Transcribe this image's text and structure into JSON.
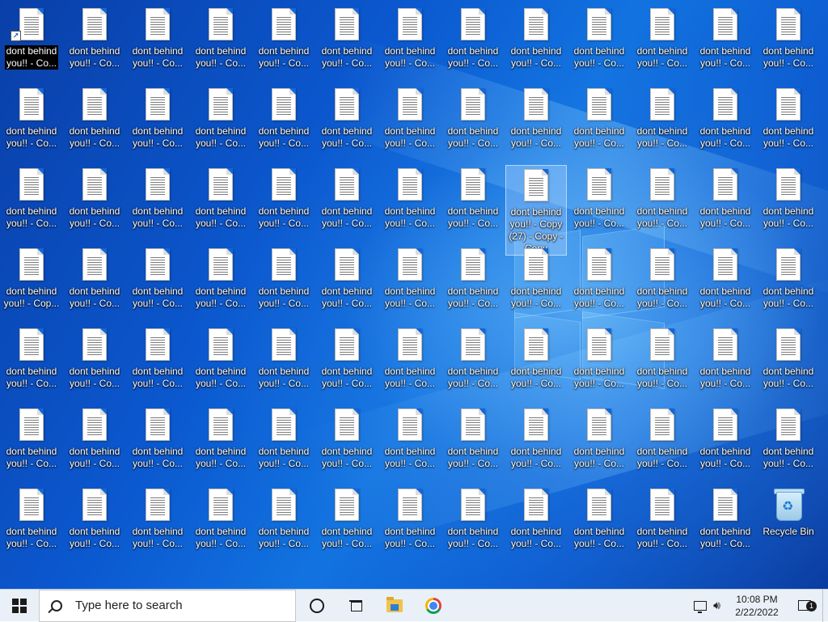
{
  "desktop": {
    "file_label_line1": "dont behind",
    "file_label_line2": "you!! - Co...",
    "row4_first_label_line2": "you!! - Cop...",
    "first_label_line1": "dont behind",
    "first_label_line2": "you!! - Co...",
    "selected_label": [
      "dont behind",
      "you!! - Copy",
      "(27) - Copy -",
      "Copy"
    ],
    "recycle_bin_label": "Recycle Bin",
    "icon_type": "text-file-icon"
  },
  "taskbar": {
    "search_placeholder": "Type here to search",
    "pinned": [
      "cortana-icon",
      "task-view-icon",
      "file-explorer-icon",
      "chrome-icon"
    ],
    "tray": {
      "time": "10:08 PM",
      "date": "2/22/2022",
      "notification_count": "1"
    }
  },
  "colors": {
    "desktop_blue": "#0b58cf",
    "taskbar_bg": "#e9f0f7",
    "selection": "#aad2ff"
  }
}
